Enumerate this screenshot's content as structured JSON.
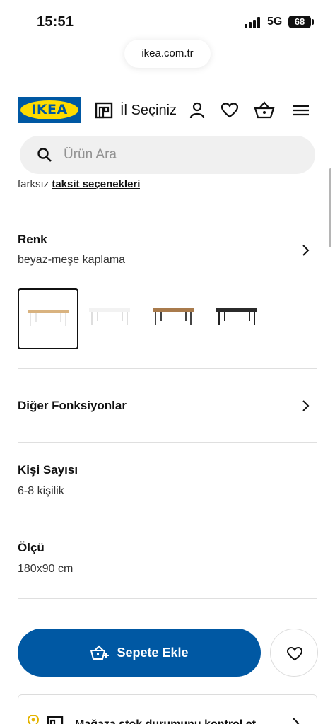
{
  "status_bar": {
    "time": "15:51",
    "network": "5G",
    "battery": "68"
  },
  "browser": {
    "url": "ikea.com.tr"
  },
  "header": {
    "logo_text": "IKEA",
    "store_label": "İl Seçiniz"
  },
  "search": {
    "placeholder": "Ürün Ara"
  },
  "installment": {
    "prefix": "farksız ",
    "link": "taksit seçenekleri"
  },
  "color": {
    "label": "Renk",
    "value": "beyaz-meşe kaplama",
    "swatches": [
      {
        "name": "beyaz-meşe kaplama",
        "top": "#d9b380",
        "legs": "#e6e6e6",
        "selected": true
      },
      {
        "name": "beyaz",
        "top": "#f2f2f2",
        "legs": "#dedede",
        "selected": false
      },
      {
        "name": "meşe-siyah",
        "top": "#a97b4c",
        "legs": "#444444",
        "selected": false
      },
      {
        "name": "siyah",
        "top": "#2b2b2b",
        "legs": "#222222",
        "selected": false
      }
    ]
  },
  "other_functions": {
    "label": "Diğer Fonksiyonlar"
  },
  "people": {
    "label": "Kişi Sayısı",
    "value": "6-8 kişilik"
  },
  "size": {
    "label": "Ölçü",
    "value": "180x90 cm"
  },
  "actions": {
    "add_to_cart": "Sepete Ekle"
  },
  "stock": {
    "text": "Mağaza stok durumunu kontrol et"
  },
  "colors": {
    "brand_blue": "#0058a3",
    "brand_yellow": "#ffdb00"
  }
}
